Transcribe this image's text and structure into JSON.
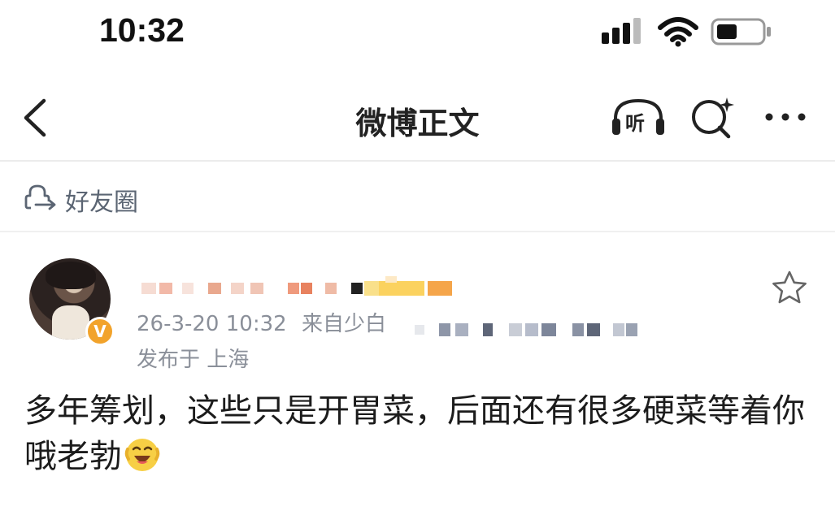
{
  "status_bar": {
    "time": "10:32"
  },
  "nav": {
    "title": "微博正文",
    "listen_label": "听"
  },
  "circle": {
    "label": "好友圈"
  },
  "post": {
    "date_time": "26-3-20 10:32",
    "source_prefix": "来自",
    "source_name": "少白",
    "location": "发布于 上海",
    "verified_badge": "V",
    "text": "多年筹划，这些只是开胃菜，后面还有很多硬菜等着你哦老勃",
    "emoji": "laughing-emoji-icon"
  },
  "colors": {
    "badge": "#f2a32b",
    "meta": "#8a8f99",
    "circle_label": "#5b6573"
  }
}
